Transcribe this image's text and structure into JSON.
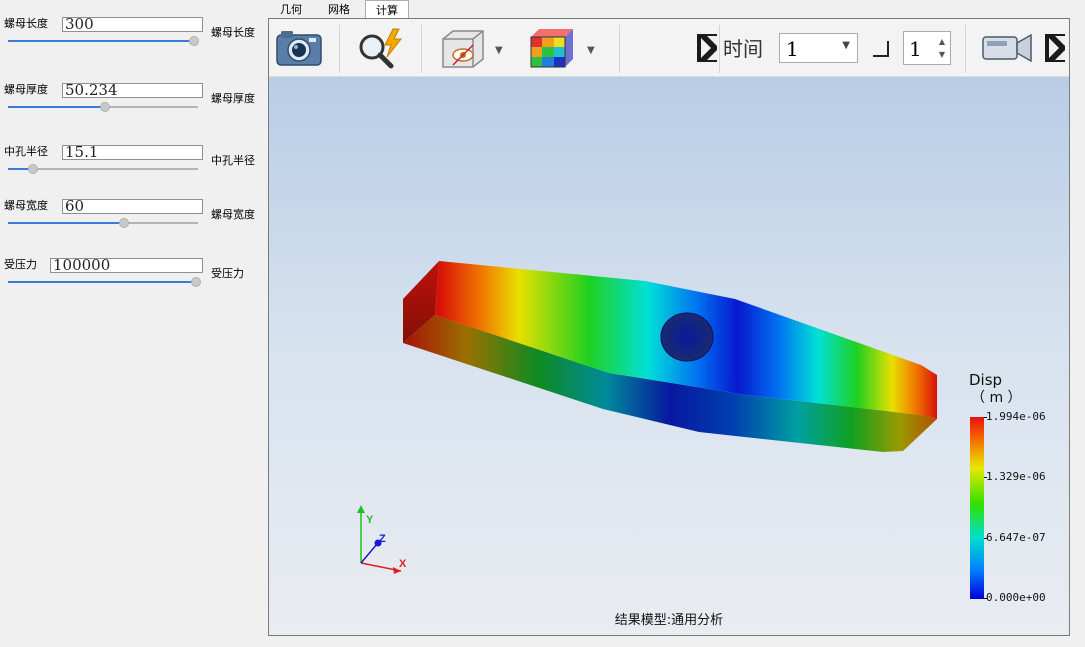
{
  "tabs": [
    {
      "label": "几何"
    },
    {
      "label": "网格"
    },
    {
      "label": "计算"
    }
  ],
  "params": [
    {
      "label": "螺母长度",
      "value": "300",
      "right_label": "螺母长度",
      "slider_fraction": 0.98
    },
    {
      "label": "螺母厚度",
      "value": "50.234",
      "right_label": "螺母厚度",
      "slider_fraction": 0.51
    },
    {
      "label": "中孔半径",
      "value": "15.1",
      "right_label": "中孔半径",
      "slider_fraction": 0.13
    },
    {
      "label": "螺母宽度",
      "value": "60",
      "right_label": "螺母宽度",
      "slider_fraction": 0.61
    },
    {
      "label": "受压力",
      "value": "100000",
      "right_label": "受压力",
      "slider_fraction": 0.99
    }
  ],
  "toolbar": {
    "icons": [
      "camera-icon",
      "search-flash-icon",
      "box-visibility-icon",
      "colormap-cube-icon",
      "video-camera-icon"
    ],
    "time_label": "时间",
    "time_value": "1",
    "step_value": "1"
  },
  "viewport": {
    "axes": {
      "x": "X",
      "y": "Y",
      "z": "Z"
    },
    "legend": {
      "title": "Disp",
      "unit": "（ m ）",
      "ticks": [
        "1.994e-06",
        "1.329e-06",
        "6.647e-07",
        "0.000e+00"
      ]
    },
    "caption": "结果模型:通用分析"
  },
  "colors": {
    "accent": "#3a7bd5",
    "legend_max": "#e81010",
    "legend_min": "#0000d8"
  }
}
